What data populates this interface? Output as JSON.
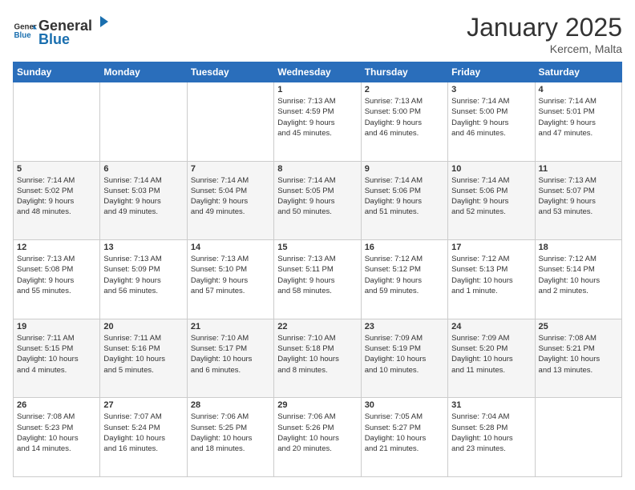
{
  "header": {
    "logo_general": "General",
    "logo_blue": "Blue",
    "month": "January 2025",
    "location": "Kercem, Malta"
  },
  "weekdays": [
    "Sunday",
    "Monday",
    "Tuesday",
    "Wednesday",
    "Thursday",
    "Friday",
    "Saturday"
  ],
  "weeks": [
    [
      {
        "day": "",
        "info": ""
      },
      {
        "day": "",
        "info": ""
      },
      {
        "day": "",
        "info": ""
      },
      {
        "day": "1",
        "info": "Sunrise: 7:13 AM\nSunset: 4:59 PM\nDaylight: 9 hours\nand 45 minutes."
      },
      {
        "day": "2",
        "info": "Sunrise: 7:13 AM\nSunset: 5:00 PM\nDaylight: 9 hours\nand 46 minutes."
      },
      {
        "day": "3",
        "info": "Sunrise: 7:14 AM\nSunset: 5:00 PM\nDaylight: 9 hours\nand 46 minutes."
      },
      {
        "day": "4",
        "info": "Sunrise: 7:14 AM\nSunset: 5:01 PM\nDaylight: 9 hours\nand 47 minutes."
      }
    ],
    [
      {
        "day": "5",
        "info": "Sunrise: 7:14 AM\nSunset: 5:02 PM\nDaylight: 9 hours\nand 48 minutes."
      },
      {
        "day": "6",
        "info": "Sunrise: 7:14 AM\nSunset: 5:03 PM\nDaylight: 9 hours\nand 49 minutes."
      },
      {
        "day": "7",
        "info": "Sunrise: 7:14 AM\nSunset: 5:04 PM\nDaylight: 9 hours\nand 49 minutes."
      },
      {
        "day": "8",
        "info": "Sunrise: 7:14 AM\nSunset: 5:05 PM\nDaylight: 9 hours\nand 50 minutes."
      },
      {
        "day": "9",
        "info": "Sunrise: 7:14 AM\nSunset: 5:06 PM\nDaylight: 9 hours\nand 51 minutes."
      },
      {
        "day": "10",
        "info": "Sunrise: 7:14 AM\nSunset: 5:06 PM\nDaylight: 9 hours\nand 52 minutes."
      },
      {
        "day": "11",
        "info": "Sunrise: 7:13 AM\nSunset: 5:07 PM\nDaylight: 9 hours\nand 53 minutes."
      }
    ],
    [
      {
        "day": "12",
        "info": "Sunrise: 7:13 AM\nSunset: 5:08 PM\nDaylight: 9 hours\nand 55 minutes."
      },
      {
        "day": "13",
        "info": "Sunrise: 7:13 AM\nSunset: 5:09 PM\nDaylight: 9 hours\nand 56 minutes."
      },
      {
        "day": "14",
        "info": "Sunrise: 7:13 AM\nSunset: 5:10 PM\nDaylight: 9 hours\nand 57 minutes."
      },
      {
        "day": "15",
        "info": "Sunrise: 7:13 AM\nSunset: 5:11 PM\nDaylight: 9 hours\nand 58 minutes."
      },
      {
        "day": "16",
        "info": "Sunrise: 7:12 AM\nSunset: 5:12 PM\nDaylight: 9 hours\nand 59 minutes."
      },
      {
        "day": "17",
        "info": "Sunrise: 7:12 AM\nSunset: 5:13 PM\nDaylight: 10 hours\nand 1 minute."
      },
      {
        "day": "18",
        "info": "Sunrise: 7:12 AM\nSunset: 5:14 PM\nDaylight: 10 hours\nand 2 minutes."
      }
    ],
    [
      {
        "day": "19",
        "info": "Sunrise: 7:11 AM\nSunset: 5:15 PM\nDaylight: 10 hours\nand 4 minutes."
      },
      {
        "day": "20",
        "info": "Sunrise: 7:11 AM\nSunset: 5:16 PM\nDaylight: 10 hours\nand 5 minutes."
      },
      {
        "day": "21",
        "info": "Sunrise: 7:10 AM\nSunset: 5:17 PM\nDaylight: 10 hours\nand 6 minutes."
      },
      {
        "day": "22",
        "info": "Sunrise: 7:10 AM\nSunset: 5:18 PM\nDaylight: 10 hours\nand 8 minutes."
      },
      {
        "day": "23",
        "info": "Sunrise: 7:09 AM\nSunset: 5:19 PM\nDaylight: 10 hours\nand 10 minutes."
      },
      {
        "day": "24",
        "info": "Sunrise: 7:09 AM\nSunset: 5:20 PM\nDaylight: 10 hours\nand 11 minutes."
      },
      {
        "day": "25",
        "info": "Sunrise: 7:08 AM\nSunset: 5:21 PM\nDaylight: 10 hours\nand 13 minutes."
      }
    ],
    [
      {
        "day": "26",
        "info": "Sunrise: 7:08 AM\nSunset: 5:23 PM\nDaylight: 10 hours\nand 14 minutes."
      },
      {
        "day": "27",
        "info": "Sunrise: 7:07 AM\nSunset: 5:24 PM\nDaylight: 10 hours\nand 16 minutes."
      },
      {
        "day": "28",
        "info": "Sunrise: 7:06 AM\nSunset: 5:25 PM\nDaylight: 10 hours\nand 18 minutes."
      },
      {
        "day": "29",
        "info": "Sunrise: 7:06 AM\nSunset: 5:26 PM\nDaylight: 10 hours\nand 20 minutes."
      },
      {
        "day": "30",
        "info": "Sunrise: 7:05 AM\nSunset: 5:27 PM\nDaylight: 10 hours\nand 21 minutes."
      },
      {
        "day": "31",
        "info": "Sunrise: 7:04 AM\nSunset: 5:28 PM\nDaylight: 10 hours\nand 23 minutes."
      },
      {
        "day": "",
        "info": ""
      }
    ]
  ]
}
